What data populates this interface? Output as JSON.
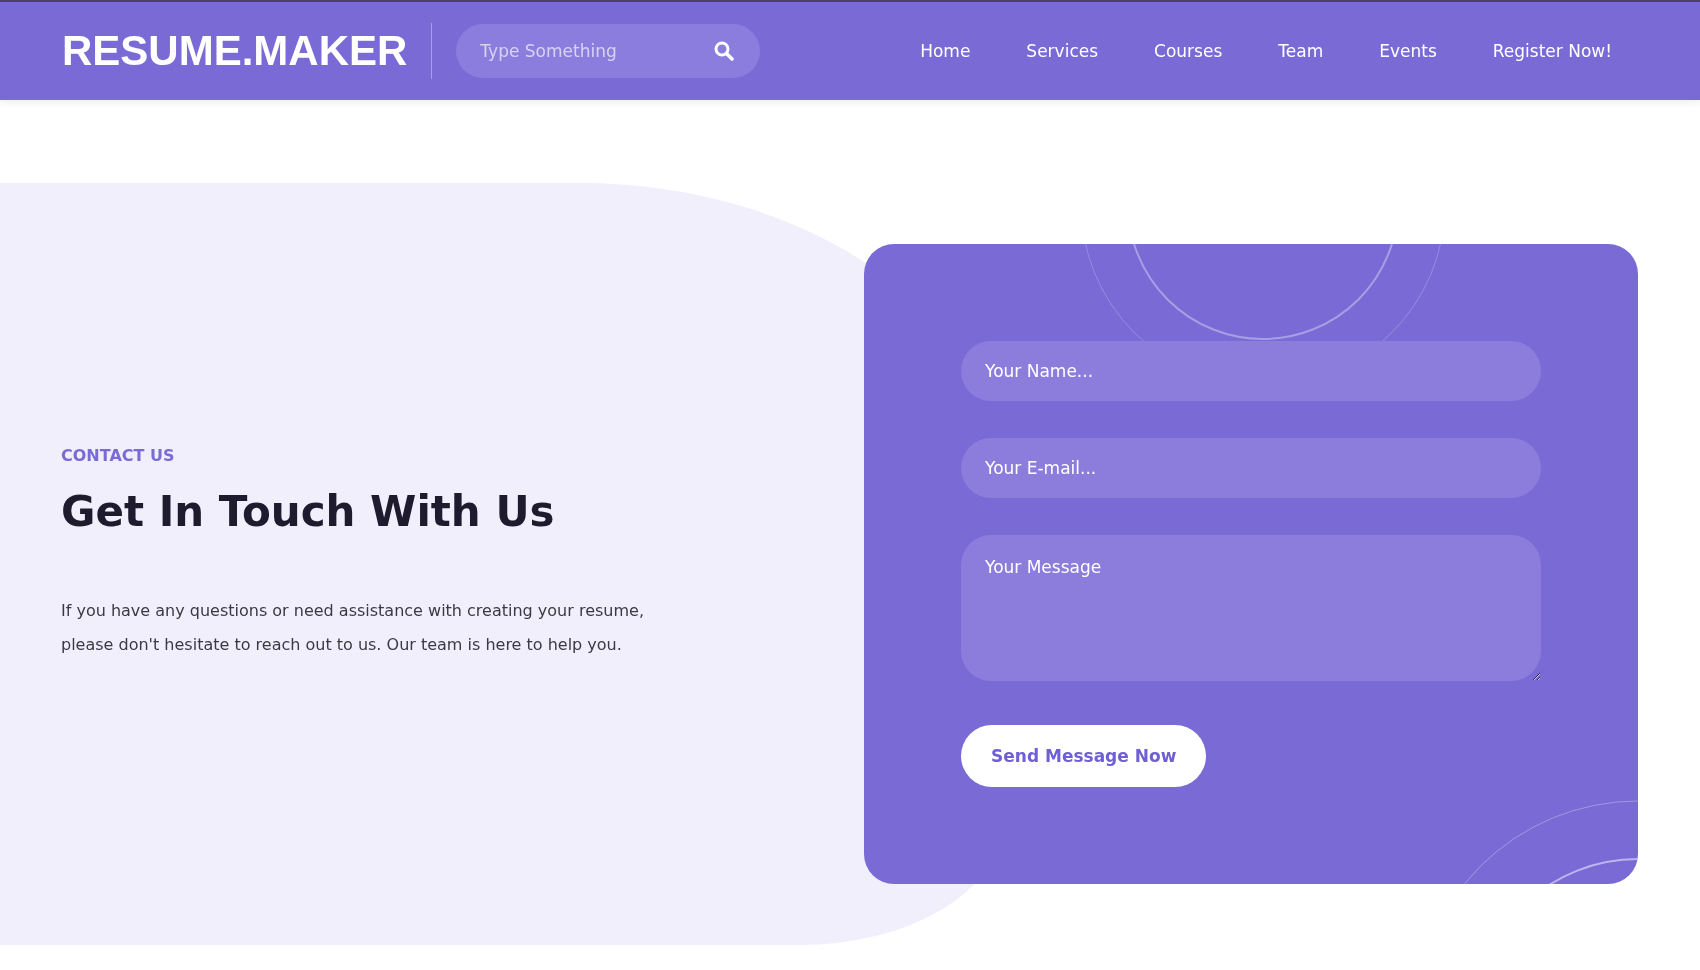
{
  "header": {
    "logo": "RESUME.MAKER",
    "search": {
      "placeholder": "Type Something"
    },
    "nav": [
      {
        "label": "Home"
      },
      {
        "label": "Services"
      },
      {
        "label": "Courses"
      },
      {
        "label": "Team"
      },
      {
        "label": "Events"
      },
      {
        "label": "Register Now!"
      }
    ]
  },
  "contact": {
    "eyebrow": "CONTACT US",
    "heading": "Get In Touch With Us",
    "text": "If you have any questions or need assistance with creating your resume, please don't hesitate to reach out to us. Our team is here to help you.",
    "form": {
      "fields": [
        {
          "kind": "input",
          "placeholder": "Your Name..."
        },
        {
          "kind": "input",
          "placeholder": "Your E-mail..."
        },
        {
          "kind": "textarea",
          "placeholder": "Your Message"
        }
      ],
      "submit": "Send Message Now"
    }
  }
}
